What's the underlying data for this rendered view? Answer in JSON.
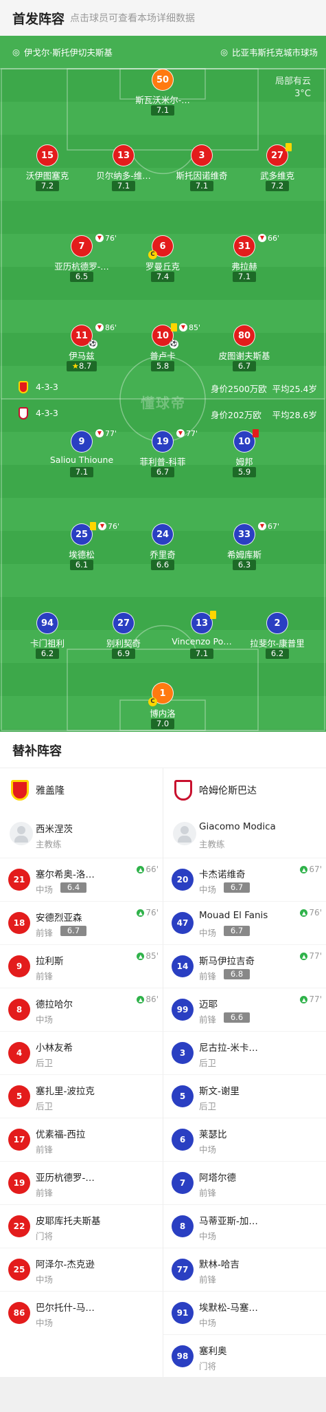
{
  "header": {
    "title": "首发阵容",
    "subtitle": "点击球员可查看本场详细数据"
  },
  "colors": {
    "field": "#3da84a",
    "home": "#e31c1c",
    "away": "#2a3fc2",
    "goalkeeper": "#ff7a10"
  },
  "venue": {
    "stadium_left": "伊戈尔·斯托伊切夫斯基",
    "stadium_right": "比亚韦斯托克城市球场",
    "weather": "局部有云",
    "temperature": "3°C"
  },
  "watermark": "懂球帝",
  "home_team": {
    "name": "雅盖隆",
    "formation": "4-3-3",
    "value": "身价2500万欧",
    "avg_age": "平均25.4岁"
  },
  "away_team": {
    "name": "哈姆伦斯巴达",
    "formation": "4-3-3",
    "value": "身价202万欧",
    "avg_age": "平均28.6岁"
  },
  "field_players": [
    {
      "num": "50",
      "name": "斯瓦沃米尔-…",
      "rating": "7.1",
      "side": "home",
      "gk": true,
      "icons": []
    },
    {
      "num": "15",
      "name": "沃伊图塞克",
      "rating": "7.2",
      "side": "home",
      "icons": []
    },
    {
      "num": "13",
      "name": "贝尔纳多-维…",
      "rating": "7.1",
      "side": "home",
      "icons": []
    },
    {
      "num": "3",
      "name": "斯托因诺维奇",
      "rating": "7.1",
      "side": "home",
      "icons": []
    },
    {
      "num": "27",
      "name": "武多维克",
      "rating": "7.2",
      "side": "home",
      "icons": [
        "yellow"
      ]
    },
    {
      "num": "7",
      "name": "亚历杭德罗-…",
      "rating": "6.5",
      "side": "home",
      "icons": [
        "sub"
      ],
      "sub_minute": "76'"
    },
    {
      "num": "6",
      "name": "罗曼丘克",
      "rating": "7.4",
      "side": "home",
      "icons": [
        "captain"
      ],
      "captain": "C"
    },
    {
      "num": "31",
      "name": "弗拉赫",
      "rating": "7.1",
      "side": "home",
      "icons": [
        "sub"
      ],
      "sub_minute": "66'"
    },
    {
      "num": "11",
      "name": "伊马兹",
      "rating": "8.7",
      "side": "home",
      "icons": [
        "sub",
        "ball",
        "star"
      ],
      "sub_minute": "86'"
    },
    {
      "num": "10",
      "name": "普卢卡",
      "rating": "5.8",
      "side": "home",
      "icons": [
        "yellow",
        "sub",
        "ball"
      ],
      "sub_minute": "85'"
    },
    {
      "num": "80",
      "name": "皮图谢夫斯基",
      "rating": "6.7",
      "side": "home",
      "icons": []
    },
    {
      "num": "9",
      "name": "Saliou Thioune",
      "rating": "7.1",
      "side": "away",
      "icons": [
        "sub"
      ],
      "sub_minute": "77'"
    },
    {
      "num": "19",
      "name": "菲利普-科菲",
      "rating": "6.7",
      "side": "away",
      "icons": [
        "sub"
      ],
      "sub_minute": "77'"
    },
    {
      "num": "10",
      "name": "姆邦",
      "rating": "5.9",
      "side": "away",
      "icons": [
        "red"
      ]
    },
    {
      "num": "25",
      "name": "埃德松",
      "rating": "6.1",
      "side": "away",
      "icons": [
        "yellow",
        "sub"
      ],
      "sub_minute": "76'"
    },
    {
      "num": "24",
      "name": "乔里奇",
      "rating": "6.6",
      "side": "away",
      "icons": []
    },
    {
      "num": "33",
      "name": "希姆库斯",
      "rating": "6.3",
      "side": "away",
      "icons": [
        "sub"
      ],
      "sub_minute": "67'"
    },
    {
      "num": "94",
      "name": "卡门祖利",
      "rating": "6.2",
      "side": "away",
      "icons": []
    },
    {
      "num": "27",
      "name": "别利契奇",
      "rating": "6.9",
      "side": "away",
      "icons": []
    },
    {
      "num": "13",
      "name": "Vincenzo Po…",
      "rating": "7.1",
      "side": "away",
      "icons": [
        "yellow"
      ]
    },
    {
      "num": "2",
      "name": "拉斐尔-康普里",
      "rating": "6.2",
      "side": "away",
      "icons": []
    },
    {
      "num": "1",
      "name": "博内洛",
      "rating": "7.0",
      "side": "away",
      "gk": true,
      "icons": [
        "captain"
      ],
      "captain": "C"
    }
  ],
  "bench": {
    "title": "替补阵容",
    "home": {
      "team": "雅盖隆",
      "coach_name": "西米涅茨",
      "coach_role": "主教练",
      "players": [
        {
          "num": "21",
          "name": "塞尔希奥-洛…",
          "pos": "中场",
          "rating": "6.4",
          "sub": "66'"
        },
        {
          "num": "18",
          "name": "安德烈亚森",
          "pos": "前锋",
          "rating": "6.7",
          "sub": "76'"
        },
        {
          "num": "9",
          "name": "拉利斯",
          "pos": "前锋",
          "rating": "",
          "sub": "85'"
        },
        {
          "num": "8",
          "name": "德拉哈尔",
          "pos": "中场",
          "rating": "",
          "sub": "86'"
        },
        {
          "num": "4",
          "name": "小林友希",
          "pos": "后卫",
          "rating": "",
          "sub": ""
        },
        {
          "num": "5",
          "name": "塞扎里-波拉克",
          "pos": "后卫",
          "rating": "",
          "sub": ""
        },
        {
          "num": "17",
          "name": "优素福-西拉",
          "pos": "前锋",
          "rating": "",
          "sub": ""
        },
        {
          "num": "19",
          "name": "亚历杭德罗-…",
          "pos": "前锋",
          "rating": "",
          "sub": ""
        },
        {
          "num": "22",
          "name": "皮耶库托夫斯基",
          "pos": "门将",
          "rating": "",
          "sub": ""
        },
        {
          "num": "25",
          "name": "阿泽尔-杰克逊",
          "pos": "中场",
          "rating": "",
          "sub": ""
        },
        {
          "num": "86",
          "name": "巴尔托什-马…",
          "pos": "中场",
          "rating": "",
          "sub": ""
        }
      ]
    },
    "away": {
      "team": "哈姆伦斯巴达",
      "coach_name": "Giacomo Modica",
      "coach_role": "主教练",
      "players": [
        {
          "num": "20",
          "name": "卡杰诺维奇",
          "pos": "中场",
          "rating": "6.7",
          "sub": "67'"
        },
        {
          "num": "47",
          "name": "Mouad El Fanis",
          "pos": "中场",
          "rating": "6.7",
          "sub": "76'"
        },
        {
          "num": "14",
          "name": "斯马伊拉吉奇",
          "pos": "前锋",
          "rating": "6.8",
          "sub": "77'"
        },
        {
          "num": "99",
          "name": "迈耶",
          "pos": "前锋",
          "rating": "6.6",
          "sub": "77'"
        },
        {
          "num": "3",
          "name": "尼古拉-米卡…",
          "pos": "后卫",
          "rating": "",
          "sub": ""
        },
        {
          "num": "5",
          "name": "斯文-谢里",
          "pos": "后卫",
          "rating": "",
          "sub": ""
        },
        {
          "num": "6",
          "name": "莱瑟比",
          "pos": "中场",
          "rating": "",
          "sub": ""
        },
        {
          "num": "7",
          "name": "阿塔尔德",
          "pos": "前锋",
          "rating": "",
          "sub": ""
        },
        {
          "num": "8",
          "name": "马蒂亚斯-加…",
          "pos": "中场",
          "rating": "",
          "sub": ""
        },
        {
          "num": "77",
          "name": "默林-哈吉",
          "pos": "前锋",
          "rating": "",
          "sub": ""
        },
        {
          "num": "91",
          "name": "埃默松-马塞…",
          "pos": "中场",
          "rating": "",
          "sub": ""
        },
        {
          "num": "98",
          "name": "塞利奥",
          "pos": "门将",
          "rating": "",
          "sub": ""
        }
      ]
    }
  }
}
